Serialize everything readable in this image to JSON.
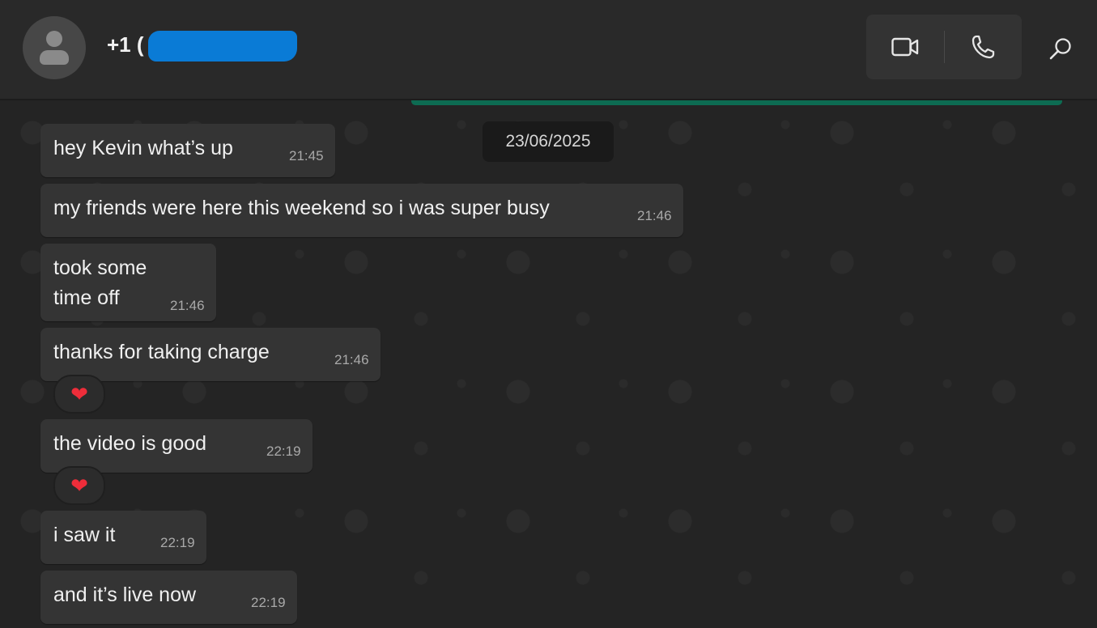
{
  "header": {
    "contact_name": "+1 (",
    "icons": {
      "avatar": "person-icon",
      "video": "video-call-icon",
      "voice": "phone-icon",
      "search": "search-icon"
    }
  },
  "chat": {
    "date": "23/06/2025",
    "messages": [
      {
        "text": "hey Kevin what’s up",
        "time": "21:45"
      },
      {
        "text": "my friends were here this weekend so i was super busy",
        "time": "21:46"
      },
      {
        "text_line1": "took some",
        "text_line2": "time off",
        "time": "21:46"
      },
      {
        "text": "thanks for taking charge",
        "time": "21:46",
        "reaction": "❤"
      },
      {
        "text": "the video is good",
        "time": "22:19",
        "reaction": "❤"
      },
      {
        "text": "i saw it",
        "time": "22:19"
      },
      {
        "text": "and it’s live now",
        "time": "22:19"
      }
    ]
  },
  "colors": {
    "header_bg": "#292929",
    "bubble_bg": "#343434",
    "accent_green": "#0d6b52",
    "redaction_blue": "#0a7bd6",
    "heart": "#ee2d3a"
  }
}
